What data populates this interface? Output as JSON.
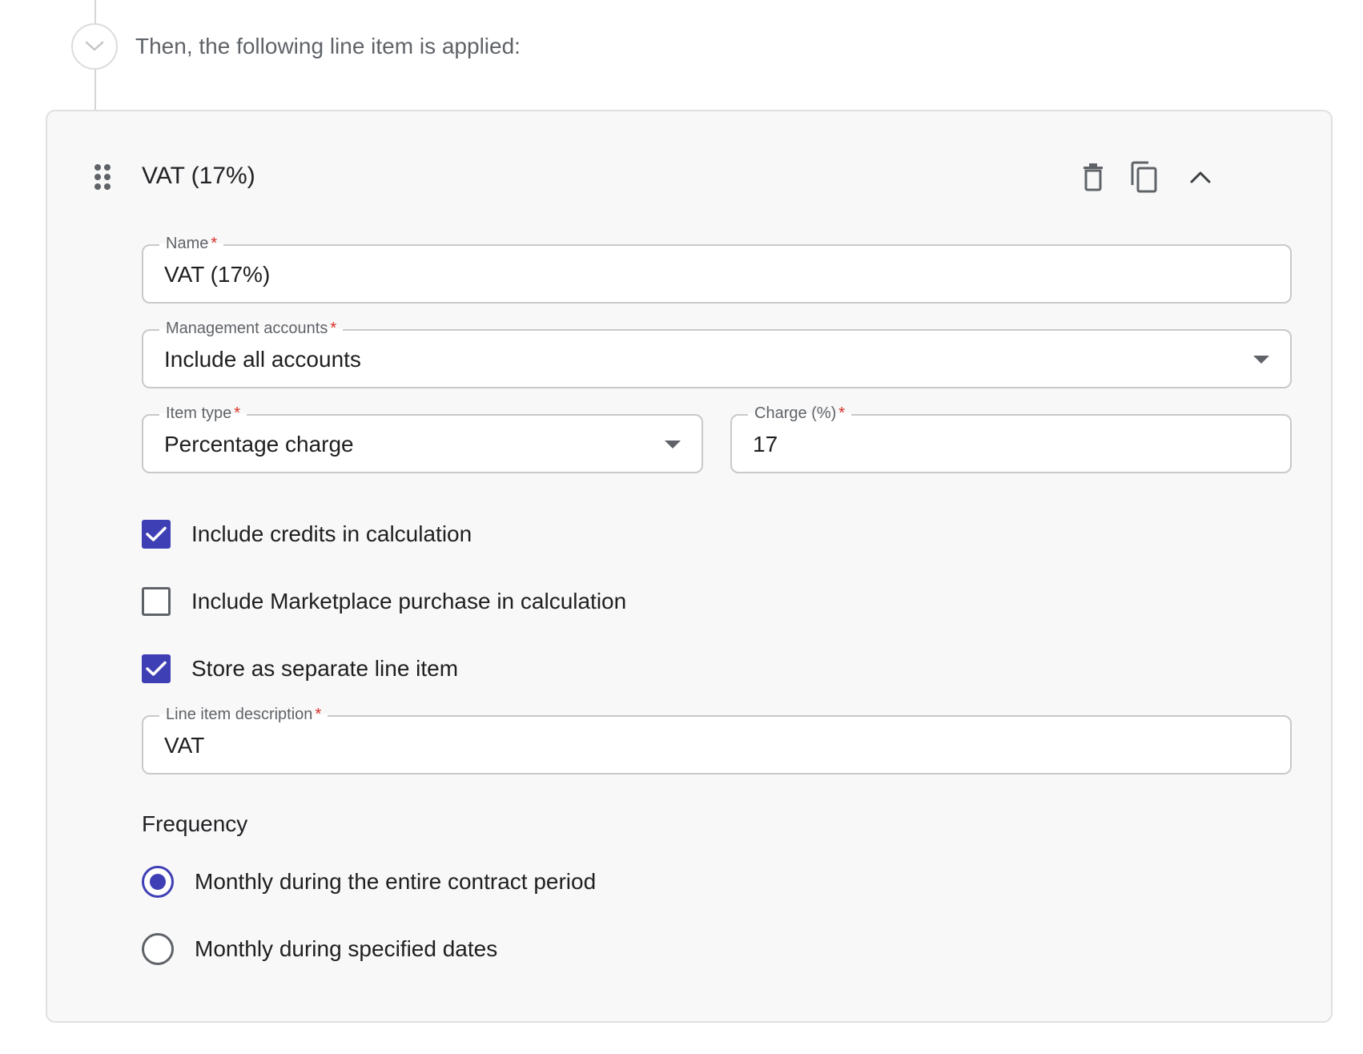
{
  "step": {
    "text": "Then, the following line item is applied:",
    "icon": "chevron-down-icon"
  },
  "card": {
    "title": "VAT (17%)",
    "actions": {
      "delete_icon": "trash-icon",
      "duplicate_icon": "copy-icon",
      "collapse_icon": "chevron-up-icon"
    },
    "fields": {
      "name": {
        "label": "Name",
        "required": "*",
        "value": "VAT (17%)"
      },
      "management_accounts": {
        "label": "Management accounts",
        "required": "*",
        "value": "Include all accounts"
      },
      "item_type": {
        "label": "Item type",
        "required": "*",
        "value": "Percentage charge"
      },
      "charge": {
        "label": "Charge (%)",
        "required": "*",
        "value": "17"
      },
      "line_item_description": {
        "label": "Line item description",
        "required": "*",
        "value": "VAT"
      }
    },
    "checkboxes": [
      {
        "label": "Include credits in calculation",
        "checked": true
      },
      {
        "label": "Include Marketplace purchase in calculation",
        "checked": false
      },
      {
        "label": "Store as separate line item",
        "checked": true
      }
    ],
    "frequency": {
      "heading": "Frequency",
      "options": [
        {
          "label": "Monthly during the entire contract period",
          "selected": true
        },
        {
          "label": "Monthly during specified dates",
          "selected": false
        }
      ]
    }
  },
  "colors": {
    "accent": "#3f3fb5",
    "required": "#d93025",
    "card_background": "#f8f8f8",
    "border": "#c9c9c9"
  }
}
